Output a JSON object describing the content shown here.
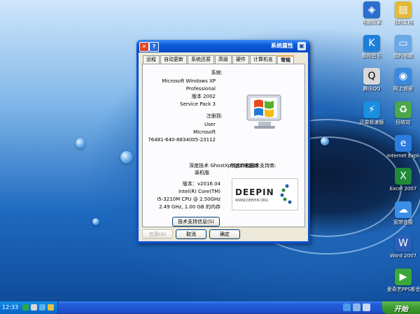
{
  "desktop": {
    "icons_right": [
      {
        "label": "我的文档",
        "icon": "my-documents-icon",
        "color": "#e2b93b",
        "glyph": "▤"
      },
      {
        "label": "我的电脑",
        "icon": "my-computer-icon",
        "color": "#6aa8e8",
        "glyph": "▭"
      },
      {
        "label": "网上邻居",
        "icon": "network-places-icon",
        "color": "#3a8be0",
        "glyph": "◉"
      },
      {
        "label": "回收站",
        "icon": "recycle-bin-icon",
        "color": "#4aa84a",
        "glyph": "♻"
      },
      {
        "label": "Internet Explorer",
        "icon": "internet-explorer-icon",
        "color": "#2d7de0",
        "glyph": "e"
      },
      {
        "label": "Excel 2007",
        "icon": "excel-icon",
        "color": "#1f8a3a",
        "glyph": "X"
      },
      {
        "label": "宽带连接",
        "icon": "broadband-connection-icon",
        "color": "#3b8ee8",
        "glyph": "☁"
      },
      {
        "label": "Word 2007",
        "icon": "word-icon",
        "color": "#2b5fb8",
        "glyph": "W"
      },
      {
        "label": "爱奇艺PPS影音",
        "icon": "iqiyi-icon",
        "color": "#3aa83a",
        "glyph": "▶"
      }
    ],
    "icons_left": [
      {
        "label": "电脑管家",
        "icon": "pc-manager-icon",
        "color": "#2a6fd0",
        "glyph": "◈"
      },
      {
        "label": "酷狗音乐",
        "icon": "kugou-icon",
        "color": "#1c7fd8",
        "glyph": "K"
      },
      {
        "label": "腾讯QQ",
        "icon": "qq-penguin-icon",
        "color": "#d8d8d8",
        "glyph": "Q"
      },
      {
        "label": "迅雷极速版",
        "icon": "thunder-icon",
        "color": "#1a8fe0",
        "glyph": "⚡"
      }
    ]
  },
  "window": {
    "title": "系统属性",
    "tabs": [
      "常规",
      "计算机名",
      "硬件",
      "高级",
      "系统还原",
      "自动更新",
      "远程"
    ],
    "system_heading": "系统:",
    "system_lines": [
      "Microsoft Windows XP",
      "Professional",
      "版本 2002",
      "Service Pack 3"
    ],
    "registered_heading": "注册到:",
    "registered_lines": [
      "User",
      "Microsoft",
      "76481-640-8834005-23112"
    ],
    "oem_lines": [
      "深度技术 GhostXp Sp3 电脑城",
      "装机版"
    ],
    "support_text": "制造商和技术支持商:",
    "hardware_lines": [
      "版本：v2016.04",
      "Intel(R) Core(TM)",
      "i5-3210M CPU @ 2.50GHz",
      "2.49 GHz, 1.00 GB 的内存"
    ],
    "deepin_brand": "DEEPIN",
    "deepin_sub": "WWW.DEEPIN.ORG",
    "support_button": "技术支持信息(S)",
    "ok_button": "确定",
    "cancel_button": "取消",
    "apply_button": "应用(A)"
  },
  "taskbar": {
    "start_label": "开始",
    "clock": "12:33"
  },
  "colors": {
    "titlebar": "#0b5bd8",
    "taskbar": "#245edb",
    "start": "#3c9a30",
    "dialog": "#ece9d8"
  }
}
